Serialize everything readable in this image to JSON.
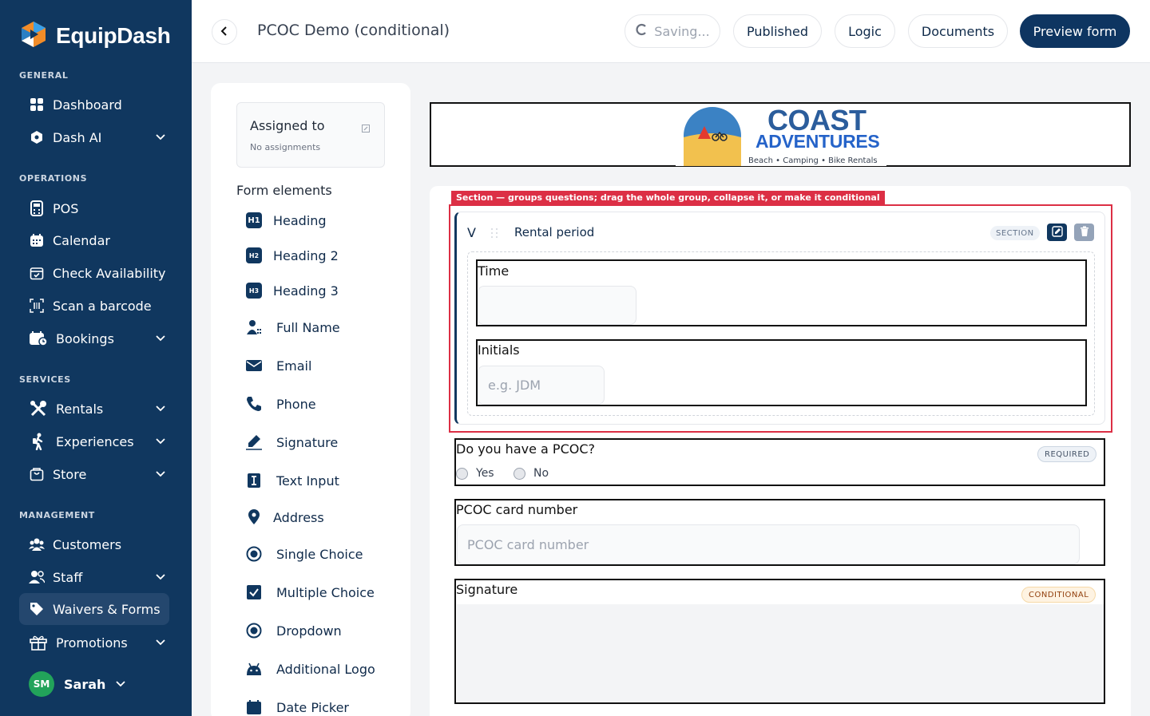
{
  "app": {
    "brand": "EquipDash",
    "brand_colors": {
      "sidebar": "#10375f",
      "accent_orange": "#f28c28",
      "accent_blue": "#3aa0e8"
    }
  },
  "sidebar": {
    "groups": {
      "general": "GENERAL",
      "operations": "OPERATIONS",
      "services": "SERVICES",
      "management": "MANAGEMENT"
    },
    "items": {
      "dashboard": "Dashboard",
      "dash_ai": "Dash AI",
      "pos": "POS",
      "calendar": "Calendar",
      "check_availability": "Check Availability",
      "scan_barcode": "Scan a barcode",
      "bookings": "Bookings",
      "rentals": "Rentals",
      "experiences": "Experiences",
      "store": "Store",
      "customers": "Customers",
      "staff": "Staff",
      "waivers_forms": "Waivers & Forms",
      "promotions": "Promotions"
    },
    "active_item": "waivers_forms",
    "user": {
      "initials": "SM",
      "name": "Sarah"
    }
  },
  "header": {
    "title": "PCOC Demo (conditional)",
    "saving": "Saving...",
    "published": "Published",
    "logic": "Logic",
    "documents": "Documents",
    "preview": "Preview form"
  },
  "panel": {
    "assigned_title": "Assigned to",
    "assigned_sub": "No assignments",
    "form_elements_title": "Form elements",
    "elements": {
      "heading": "Heading",
      "heading2": "Heading 2",
      "heading3": "Heading 3",
      "full_name": "Full Name",
      "email": "Email",
      "phone": "Phone",
      "signature": "Signature",
      "text_input": "Text Input",
      "address": "Address",
      "single_choice": "Single Choice",
      "multiple_choice": "Multiple Choice",
      "dropdown": "Dropdown",
      "additional_logo": "Additional Logo",
      "date_picker": "Date Picker"
    },
    "heading_badges": {
      "h1": "H1",
      "h2": "H2",
      "h3": "H3"
    }
  },
  "form": {
    "logo": {
      "line1": "COAST",
      "line2": "ADVENTURES",
      "tagline": "Beach • Camping • Bike Rentals"
    },
    "hint": "Section — groups questions; drag the whole group, collapse it, or make it conditional",
    "section": {
      "chevron": "V",
      "title": "Rental period",
      "badge": "SECTION",
      "fields": {
        "time": {
          "label": "Time",
          "placeholder": ""
        },
        "initials": {
          "label": "Initials",
          "placeholder": "e.g. JDM"
        }
      }
    },
    "pcoc_question": {
      "label": "Do you have a PCOC?",
      "badge": "REQUIRED",
      "options": {
        "yes": "Yes",
        "no": "No"
      }
    },
    "pcoc_number": {
      "label": "PCOC card number",
      "placeholder": "PCOC card number"
    },
    "signature": {
      "label": "Signature",
      "badge": "CONDITIONAL"
    }
  }
}
